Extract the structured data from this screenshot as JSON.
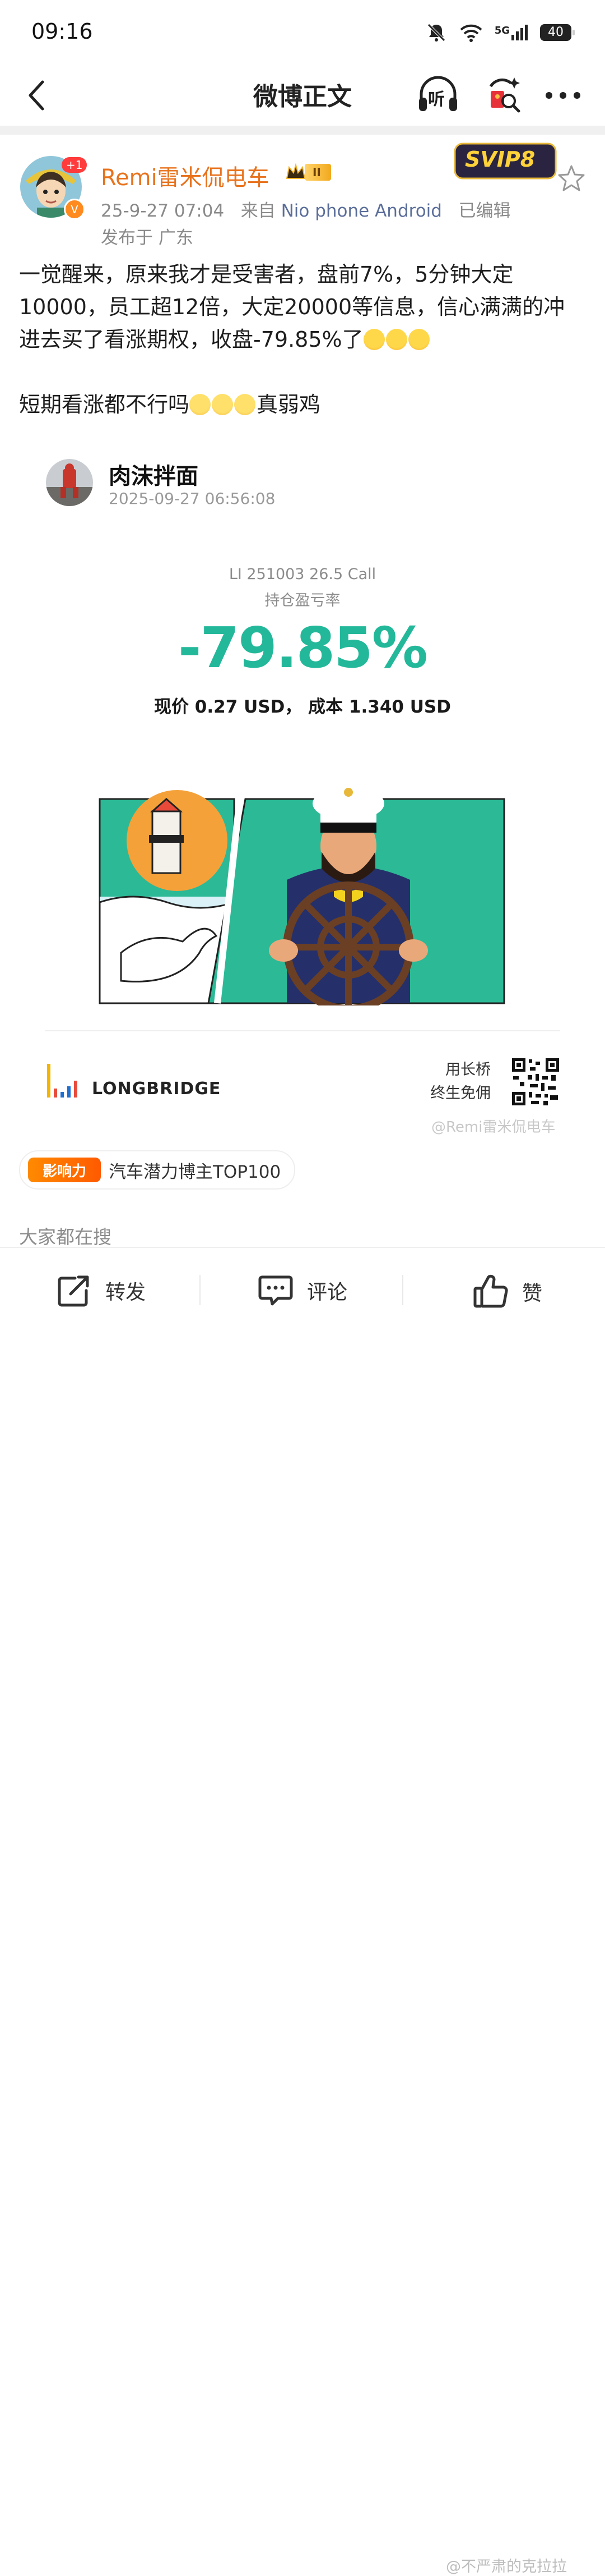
{
  "status_bar": {
    "time": "09:16",
    "network": "5G",
    "battery": "40"
  },
  "nav": {
    "title": "微博正文",
    "listen_label": "听"
  },
  "author": {
    "name": "Remi雷米侃电车",
    "badge_count": "+1",
    "verified": "V",
    "vip_level": "II",
    "svip": "SVIP8",
    "date": "25-9-27 07:04",
    "source_prefix": "来自",
    "source": "Nio phone Android",
    "edited": "已编辑",
    "location": "发布于 广东"
  },
  "post": {
    "line1": "一觉醒来，原来我才是受害者，盘前7%，5分钟大定10000，员工超12倍，大定20000等信息，信心满满的冲进去买了看涨期权，收盘-79.85%了",
    "line2_text": "短期看涨都不行吗",
    "line2_tail": "真弱鸡"
  },
  "share_card": {
    "user": "肉沫拌面",
    "time": "2025-09-27 06:56:08",
    "symbol": "LI 251003 26.5 Call",
    "label": "持仓盈亏率",
    "pnl": "-79.85%",
    "price_line": "现价 0.27 USD， 成本 1.340 USD",
    "brand": "LONGBRIDGE",
    "promo_line1": "用长桥",
    "promo_line2": "终生免佣",
    "watermark": "@Remi雷米侃电车"
  },
  "influence": {
    "icon_text": "影响力",
    "text": "汽车潜力博主TOP100"
  },
  "trending": "大家都在搜",
  "bottom_bar": {
    "repost": "转发",
    "comment": "评论",
    "like": "赞"
  },
  "bottom_watermark": "@不严肃的克拉拉",
  "colors": {
    "accent_orange": "#e8731d",
    "pnl_green": "#23b89a",
    "link_blue": "#5b6e9a"
  }
}
